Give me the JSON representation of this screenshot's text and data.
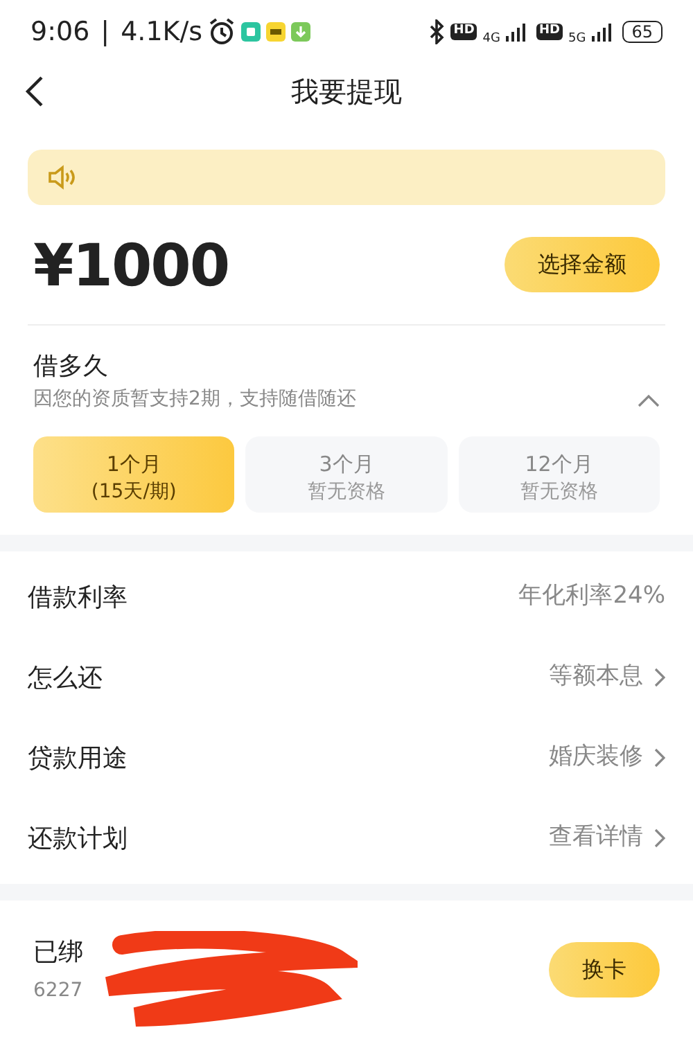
{
  "status_bar": {
    "time": "9:06",
    "separator": "|",
    "speed": "4.1K/s",
    "hd_1": "HD",
    "network_1": "4G",
    "hd_2": "HD",
    "network_2": "5G",
    "battery": "65"
  },
  "header": {
    "title": "我要提现"
  },
  "amount": {
    "value": "¥1000",
    "button": "选择金额"
  },
  "term": {
    "title": "借多久",
    "subtitle": "因您的资质暂支持2期，支持随借随还",
    "expanded": true,
    "options": [
      {
        "label": "1个月",
        "note": "(15天/期)",
        "selected": true,
        "disabled": false
      },
      {
        "label": "3个月",
        "note": "暂无资格",
        "selected": false,
        "disabled": true
      },
      {
        "label": "12个月",
        "note": "暂无资格",
        "selected": false,
        "disabled": true
      }
    ]
  },
  "details": [
    {
      "label": "借款利率",
      "value": "年化利率24%",
      "kind": "info"
    },
    {
      "label": "怎么还",
      "value": "等额本息",
      "kind": "link"
    },
    {
      "label": "贷款用途",
      "value": "婚庆装修",
      "kind": "link"
    },
    {
      "label": "还款计划",
      "value": "查看详情",
      "kind": "link"
    }
  ],
  "bank_card": {
    "title": "已绑",
    "number": "6227",
    "redacted": true,
    "button": "换卡"
  }
}
